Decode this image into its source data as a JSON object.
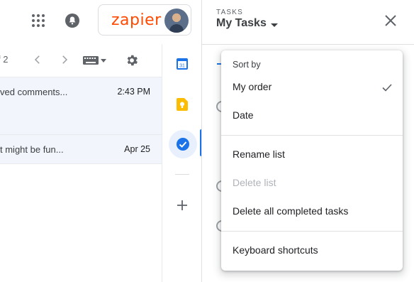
{
  "header": {
    "zapier_logo_text": "zapier",
    "brand_color": "#ff4a00"
  },
  "gmail": {
    "pager": "f 2",
    "rows": [
      {
        "snippet": "ved comments...",
        "time": "2:43 PM"
      },
      {
        "snippet": "t might be fun...",
        "time": "Apr 25"
      }
    ]
  },
  "side_strip": {
    "accent": "#1a73e8",
    "calendar_day": "31"
  },
  "tasks_panel": {
    "eyebrow": "TASKS",
    "title": "My Tasks"
  },
  "menu": {
    "sort_header": "Sort by",
    "sort_options": [
      {
        "label": "My order",
        "selected": true
      },
      {
        "label": "Date",
        "selected": false
      }
    ],
    "list_actions": [
      {
        "label": "Rename list",
        "enabled": true
      },
      {
        "label": "Delete list",
        "enabled": false
      },
      {
        "label": "Delete all completed tasks",
        "enabled": true
      }
    ],
    "other_actions": [
      {
        "label": "Keyboard shortcuts",
        "enabled": true
      }
    ]
  }
}
